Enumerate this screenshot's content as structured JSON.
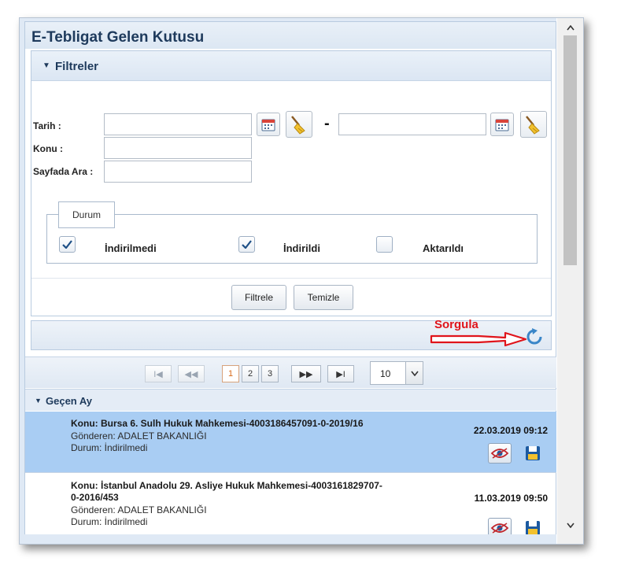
{
  "window": {
    "title": "E-Tebligat Gelen Kutusu"
  },
  "filters": {
    "section_title": "Filtreler",
    "date_label": "Tarih :",
    "date_from": {
      "value": "",
      "placeholder": ""
    },
    "date_to": {
      "value": "",
      "placeholder": ""
    },
    "date_separator": "-",
    "subject_label": "Konu :",
    "subject": {
      "value": "",
      "placeholder": ""
    },
    "page_search_label": "Sayfada Ara :",
    "page_search": {
      "value": "",
      "placeholder": ""
    },
    "status_legend": "Durum",
    "statuses": [
      {
        "label": "İndirilmedi",
        "checked": true
      },
      {
        "label": "İndirildi",
        "checked": true
      },
      {
        "label": "Aktarıldı",
        "checked": false
      }
    ],
    "filter_button": "Filtrele",
    "clear_button": "Temizle"
  },
  "annotation": {
    "text": "Sorgula",
    "color": "#e0141b"
  },
  "pager": {
    "pages": [
      "1",
      "2",
      "3"
    ],
    "current_page": "1",
    "page_size": "10"
  },
  "group": {
    "label": "Geçen Ay"
  },
  "items": [
    {
      "konu": "Konu: Bursa 6. Sulh Hukuk Mahkemesi-4003186457091-0-2019/16",
      "gonderen": "Gönderen: ADALET BAKANLIĞI",
      "durum": "Durum: İndirilmedi",
      "date": "22.03.2019 09:12",
      "selected": true
    },
    {
      "konu": "Konu: İstanbul Anadolu 29. Asliye Hukuk Mahkemesi-4003161829707-0-2016/453",
      "gonderen": "Gönderen: ADALET BAKANLIĞI",
      "durum": "Durum: İndirilmedi",
      "date": "11.03.2019 09:50",
      "selected": false
    }
  ],
  "icons": {
    "calendar": "calendar-icon",
    "broom": "broom-icon",
    "refresh": "refresh-icon",
    "view": "eye-icon",
    "save": "floppy-disk-icon"
  },
  "colors": {
    "title": "#1e3a5c",
    "selected_row": "#a9cdf3",
    "header_bg": "#dfe8f3",
    "active_page": "#d86a1a"
  }
}
